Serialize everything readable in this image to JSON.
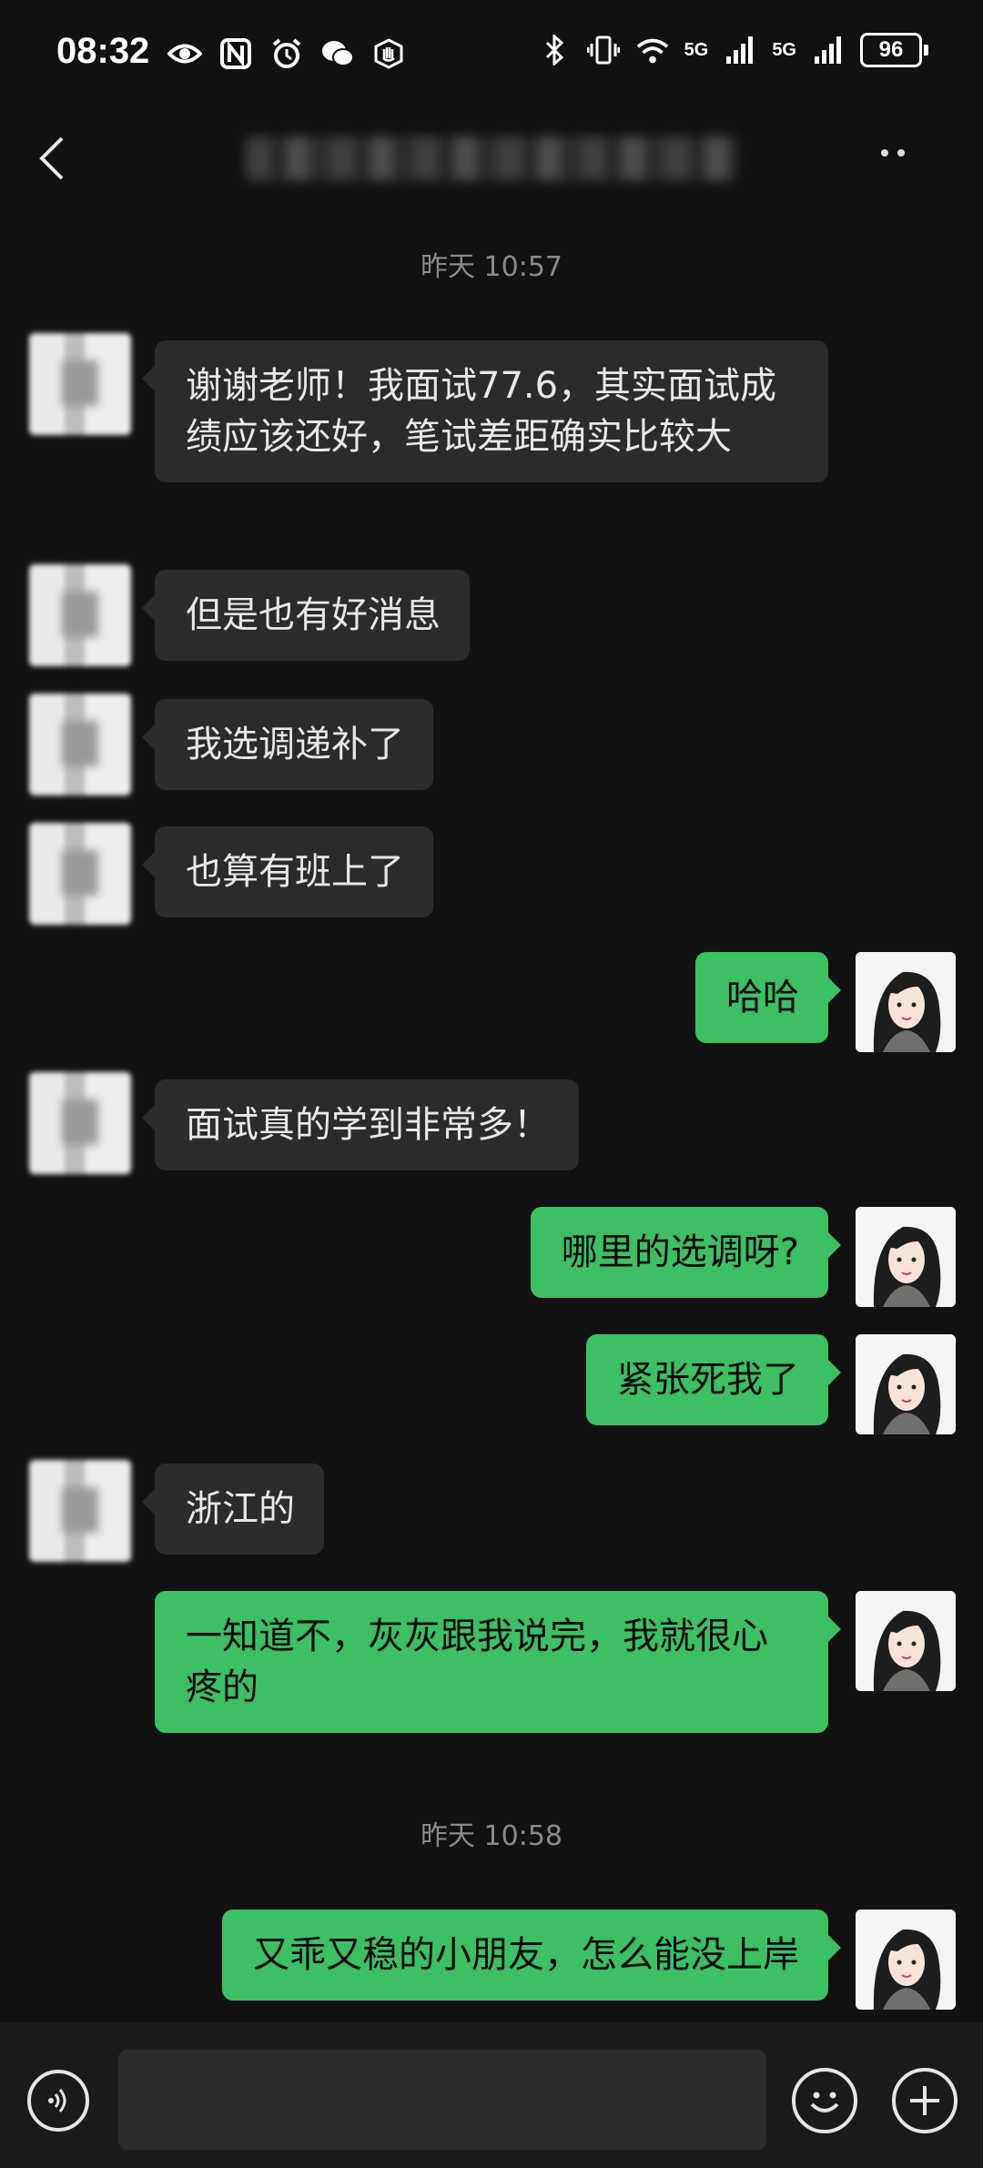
{
  "status_bar": {
    "time": "08:32",
    "left_icons": [
      "eye-icon",
      "nfc-icon",
      "alarm-icon",
      "wechat-icon",
      "hand-icon"
    ],
    "right_icons": [
      "bluetooth-icon",
      "vibrate-icon",
      "wifi-icon",
      "signal-icon",
      "signal-icon"
    ],
    "net1": "5G",
    "net2": "5G",
    "battery": "96"
  },
  "header": {
    "title": ""
  },
  "messages": [
    {
      "type": "timestamp",
      "text": "昨天 10:57"
    },
    {
      "type": "in",
      "text": "谢谢老师！我面试77.6，其实面试成绩应该还好，笔试差距确实比较大"
    },
    {
      "type": "in",
      "text": "但是也有好消息"
    },
    {
      "type": "in",
      "text": "我选调递补了"
    },
    {
      "type": "in",
      "text": "也算有班上了"
    },
    {
      "type": "out",
      "text": "哈哈"
    },
    {
      "type": "in",
      "text": "面试真的学到非常多！"
    },
    {
      "type": "out",
      "text": "哪里的选调呀?"
    },
    {
      "type": "out",
      "text": "紧张死我了"
    },
    {
      "type": "in",
      "text": "浙江的"
    },
    {
      "type": "out",
      "text": "一知道不，灰灰跟我说完，我就很心疼的"
    },
    {
      "type": "timestamp",
      "text": "昨天 10:58"
    },
    {
      "type": "out",
      "text": "又乖又稳的小朋友，怎么能没上岸"
    }
  ],
  "input": {
    "placeholder": ""
  },
  "colors": {
    "background": "#111111",
    "incoming_bubble": "#2b2b2b",
    "outgoing_bubble": "#3dbf63",
    "timestamp": "#8a8a8a"
  }
}
